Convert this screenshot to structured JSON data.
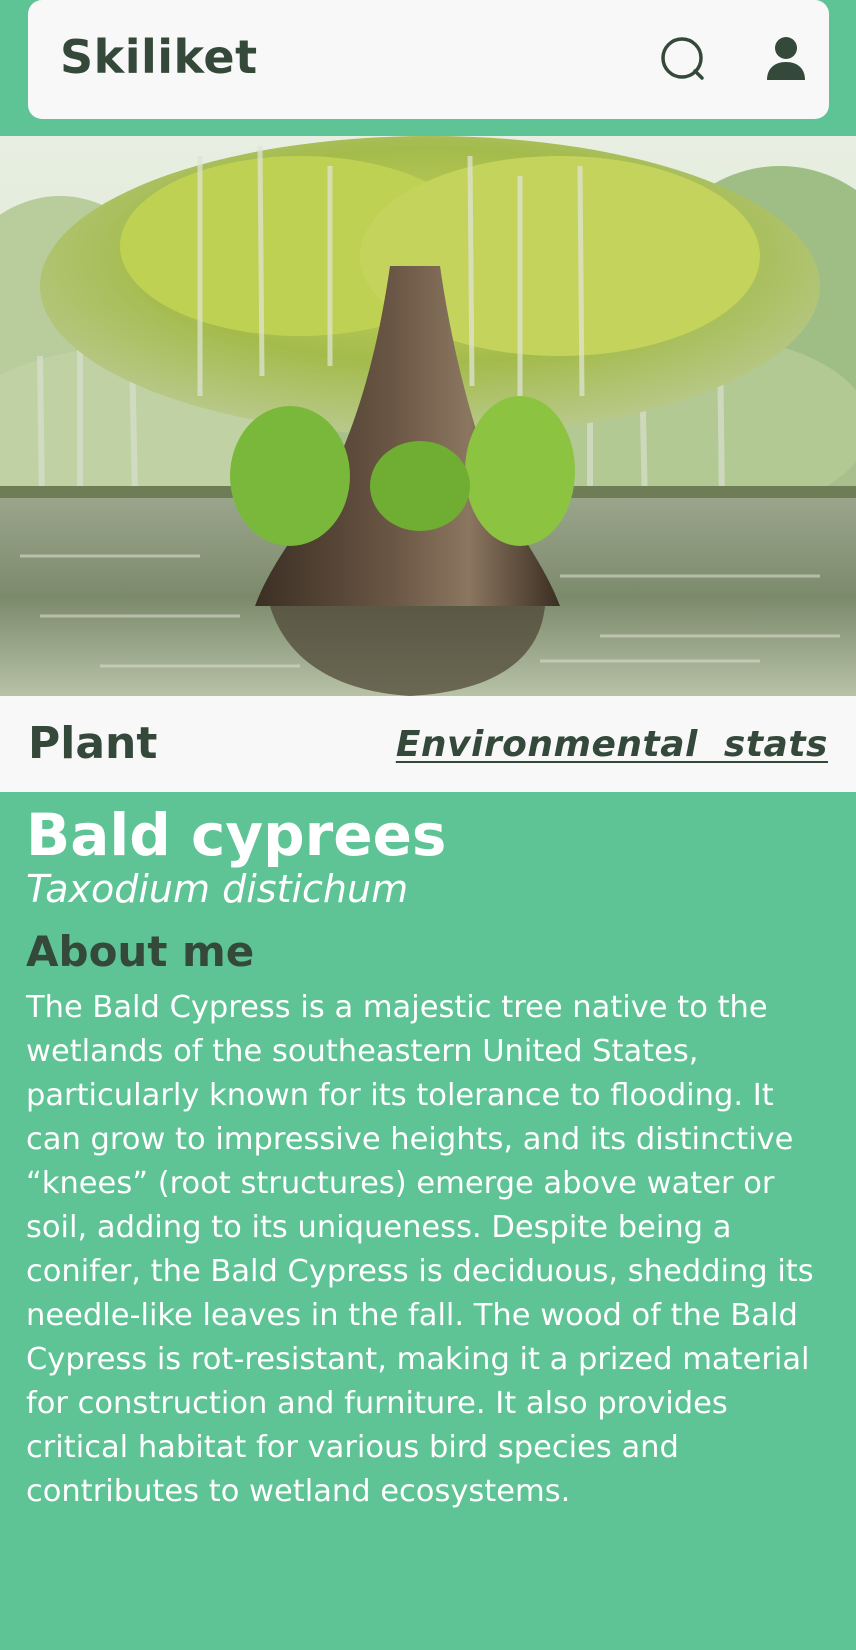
{
  "header": {
    "title": "Skiliket",
    "search_icon": "search-icon",
    "user_icon": "user-icon"
  },
  "hero": {
    "image": "bald-cypress-in-lake-photo"
  },
  "tabs": {
    "plant_label": "Plant",
    "env_label": "Environmental  stats"
  },
  "plant": {
    "common_name": "Bald cyprees",
    "scientific_name": "Taxodium distichum",
    "about_heading": "About me",
    "about_text": "The Bald Cypress is a majestic tree native to the wetlands of the southeastern United States, particularly known for its tolerance to flooding. It can grow to impressive heights, and its distinctive “knees” (root structures) emerge above water or soil, adding to its uniqueness. Despite being a conifer, the Bald Cypress is deciduous, shedding its needle-like leaves in the fall. The wood of the Bald Cypress is rot-resistant, making it a prized material for construction and furniture. It also provides critical habitat for various bird species and contributes to wetland ecosystems."
  },
  "colors": {
    "background": "#5ec395",
    "header_bg": "#f8f8f8",
    "dark_text": "#34493a",
    "light_text": "#ffffff"
  }
}
